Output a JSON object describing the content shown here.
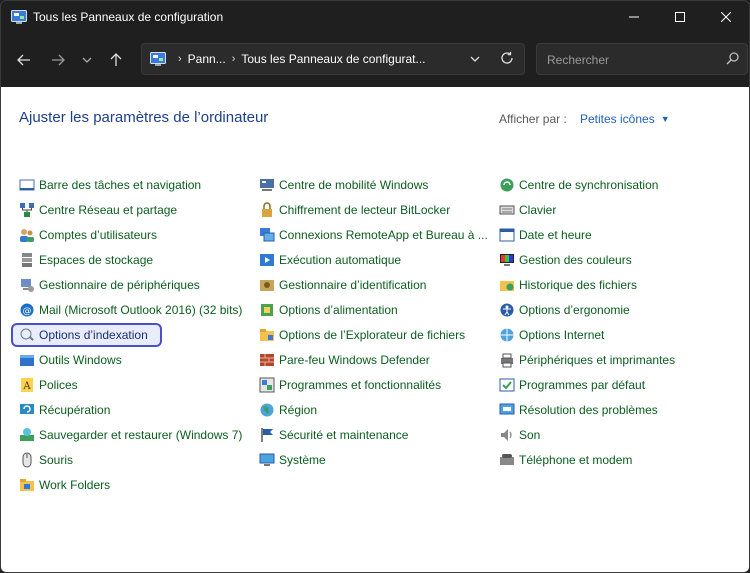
{
  "window": {
    "title": "Tous les Panneaux de configuration"
  },
  "nav": {
    "breadcrumb": [
      "Pann...",
      "Tous les Panneaux de configurat..."
    ]
  },
  "search": {
    "placeholder": "Rechercher"
  },
  "header": {
    "title": "Ajuster les paramètres de l’ordinateur",
    "view_by_label": "Afficher par :",
    "view_by_value": "Petites icônes"
  },
  "items": {
    "col1": [
      {
        "label": "Barre des tâches et navigation",
        "icon": "taskbar-icon"
      },
      {
        "label": "Centre Réseau et partage",
        "icon": "network-icon"
      },
      {
        "label": "Comptes d’utilisateurs",
        "icon": "users-icon"
      },
      {
        "label": "Espaces de stockage",
        "icon": "storage-icon"
      },
      {
        "label": "Gestionnaire de périphériques",
        "icon": "device-manager-icon"
      },
      {
        "label": "Mail (Microsoft Outlook 2016) (32 bits)",
        "icon": "mail-icon"
      },
      {
        "label": "Options d’indexation",
        "icon": "indexing-icon"
      },
      {
        "label": "Outils Windows",
        "icon": "tools-icon"
      },
      {
        "label": "Polices",
        "icon": "fonts-icon"
      },
      {
        "label": "Récupération",
        "icon": "recovery-icon"
      },
      {
        "label": "Sauvegarder et restaurer (Windows 7)",
        "icon": "backup-icon"
      },
      {
        "label": "Souris",
        "icon": "mouse-icon"
      },
      {
        "label": "Work Folders",
        "icon": "work-folders-icon"
      }
    ],
    "col2": [
      {
        "label": "Centre de mobilité Windows",
        "icon": "mobility-icon"
      },
      {
        "label": "Chiffrement de lecteur BitLocker",
        "icon": "bitlocker-icon"
      },
      {
        "label": "Connexions RemoteApp et Bureau à ...",
        "icon": "remoteapp-icon"
      },
      {
        "label": "Exécution automatique",
        "icon": "autoplay-icon"
      },
      {
        "label": "Gestionnaire d’identification",
        "icon": "credential-icon"
      },
      {
        "label": "Options d’alimentation",
        "icon": "power-icon"
      },
      {
        "label": "Options de l’Explorateur de fichiers",
        "icon": "explorer-options-icon"
      },
      {
        "label": "Pare-feu Windows Defender",
        "icon": "firewall-icon"
      },
      {
        "label": "Programmes et fonctionnalités",
        "icon": "programs-icon"
      },
      {
        "label": "Région",
        "icon": "region-icon"
      },
      {
        "label": "Sécurité et maintenance",
        "icon": "security-flag-icon"
      },
      {
        "label": "Système",
        "icon": "system-icon"
      }
    ],
    "col3": [
      {
        "label": "Centre de synchronisation",
        "icon": "sync-icon"
      },
      {
        "label": "Clavier",
        "icon": "keyboard-icon"
      },
      {
        "label": "Date et heure",
        "icon": "datetime-icon"
      },
      {
        "label": "Gestion des couleurs",
        "icon": "color-icon"
      },
      {
        "label": "Historique des fichiers",
        "icon": "file-history-icon"
      },
      {
        "label": "Options d’ergonomie",
        "icon": "ease-of-access-icon"
      },
      {
        "label": "Options Internet",
        "icon": "internet-icon"
      },
      {
        "label": "Périphériques et imprimantes",
        "icon": "printers-icon"
      },
      {
        "label": "Programmes par défaut",
        "icon": "default-programs-icon"
      },
      {
        "label": "Résolution des problèmes",
        "icon": "troubleshoot-icon"
      },
      {
        "label": "Son",
        "icon": "sound-icon"
      },
      {
        "label": "Téléphone et modem",
        "icon": "phone-modem-icon"
      }
    ]
  },
  "selected_item": "Options d’indexation",
  "colors": {
    "title_bar": "#1f1f1f",
    "link_green": "#0b5d1e",
    "heading_blue": "#1e3f8a",
    "accent": "#1f5fbf",
    "selection_border": "#4a50c8"
  }
}
